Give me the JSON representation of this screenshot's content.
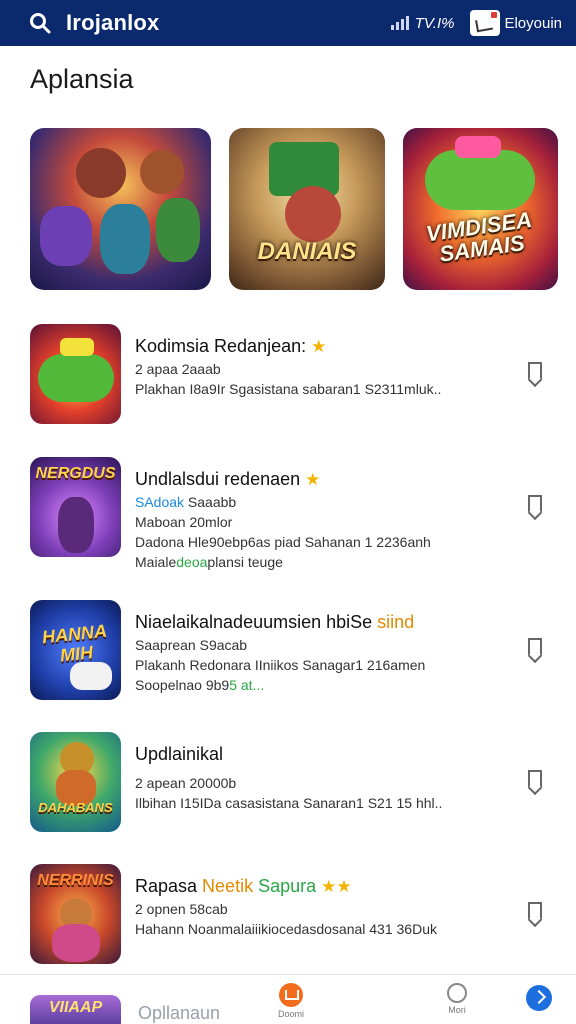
{
  "topbar": {
    "brand": "Irojanlox",
    "battery": "TV.I%",
    "account": "Eloyouin"
  },
  "page": {
    "title": "Aplansia"
  },
  "featured": [
    {
      "title": ""
    },
    {
      "title": "DANIAIS"
    },
    {
      "title": "VIMDISEA SAMAIS"
    }
  ],
  "apps": [
    {
      "title": "Kodimsia Redanjean:",
      "line1": "2 apaa 2aaab",
      "line2": "Plakhan I8a9Ir Sgasistana sabaran1 S2311mluk..",
      "line3": "",
      "line3_accent": "",
      "line3_rest": ""
    },
    {
      "title": "Undlalsdui redenaen",
      "thumb_text": "NERGDUS",
      "line1_accent": "SAdoak",
      "line1_rest": " Saaabb",
      "line2": "Maboan 20mlor",
      "line3": "Dadona Hle90ebp6as piad Sahanan 1 2236anh",
      "line4_start": "Maiale",
      "line4_accent": "deoa",
      "line4_rest": "plansi teuge"
    },
    {
      "title_start": "Niaelaikalnadeuumsien hbiSe ",
      "title_accent": "siind",
      "thumb_text": "HANNA MIH",
      "line1": "Saaprean S9acab",
      "line2": "Plakanh Redonara IIniikos Sanagar1 216amen",
      "line3_start": "Soopelnao 9b9",
      "line3_accent": "5 at..."
    },
    {
      "title": "Updlainikal",
      "thumb_text": "DAHABANS",
      "line1": "2 apean 20000b",
      "line2": "Ilbihan I15IDa casasistana Sanaran1 S21 15 hhl.."
    },
    {
      "title_start": "Rapasa ",
      "title_accent": "Neetik",
      "title_green": " Sapura",
      "thumb_text": "NERRINIS",
      "line1": "2 opnen 58cab",
      "line2": "Hahann Noanmalaiiikiocedasdosanal 431 36Duk"
    }
  ],
  "bottom": {
    "mini_thumb_text": "VIIAAP",
    "label": "Opllanaun",
    "nav_home": "Doomi",
    "nav_profile": "Mori"
  },
  "colors": {
    "topbar": "#0b2a6e",
    "accent_blue": "#1a8be0",
    "accent_green": "#28a745",
    "accent_orange": "#e38a00",
    "star": "#f2b400"
  }
}
